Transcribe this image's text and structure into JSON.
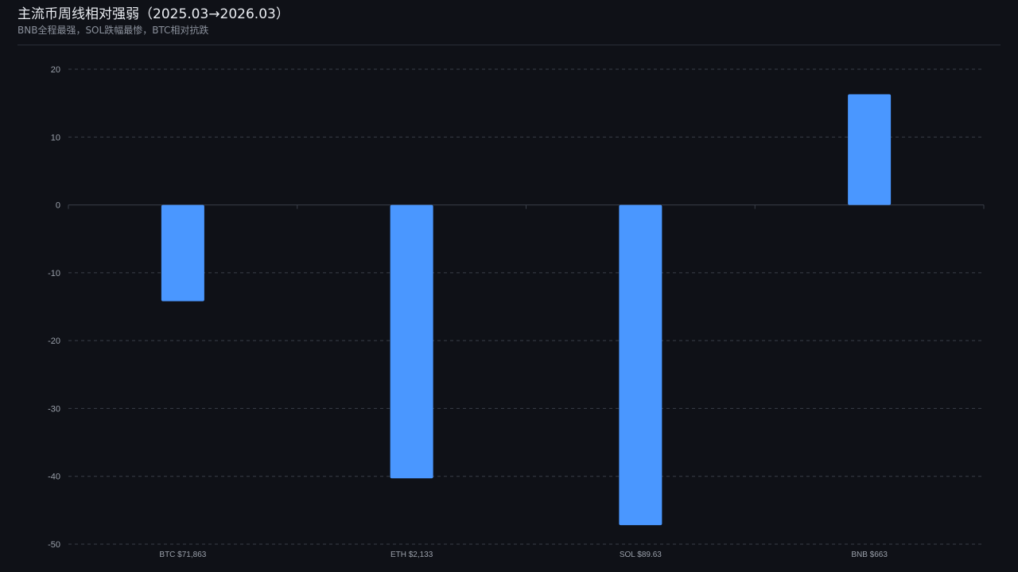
{
  "header": {
    "title": "主流币周线相对强弱（2025.03→2026.03）",
    "subtitle": "BNB全程最强，SOL跌幅最惨，BTC相对抗跌"
  },
  "colors": {
    "background": "#0f1117",
    "bar": "#4a97ff",
    "grid": "#3a3f49",
    "axis": "#3a3f49",
    "tick_text": "#9aa0aa",
    "title": "#e9ecf1",
    "subtitle": "#8b919c"
  },
  "chart_data": {
    "type": "bar",
    "categories": [
      "BTC $71,863",
      "ETH $2,133",
      "SOL $89.63",
      "BNB $663"
    ],
    "values": [
      -14.2,
      -40.3,
      -47.2,
      16.3
    ],
    "title": "",
    "xlabel": "",
    "ylabel": "",
    "ylim": [
      -50,
      20
    ],
    "yticks": [
      20,
      10,
      0,
      -10,
      -20,
      -30,
      -40,
      -50
    ],
    "grid": true,
    "grid_style": "dashed",
    "legend": "none"
  }
}
